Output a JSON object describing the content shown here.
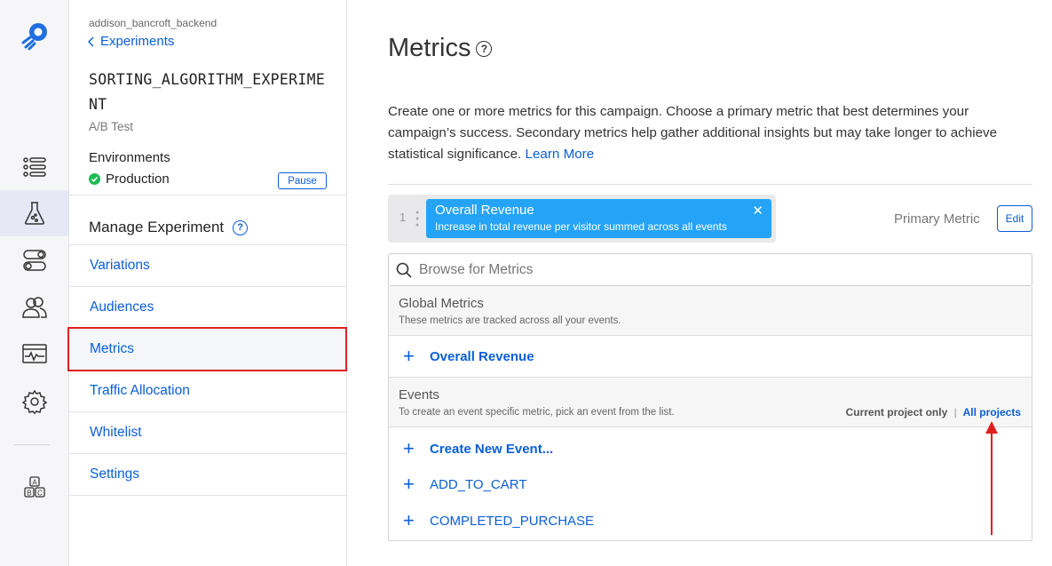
{
  "rail": {
    "items": [
      {
        "name": "list-icon"
      },
      {
        "name": "flask-icon"
      },
      {
        "name": "toggles-icon"
      },
      {
        "name": "audiences-icon"
      },
      {
        "name": "monitor-icon"
      },
      {
        "name": "gear-icon"
      },
      {
        "name": "abc-blocks-icon"
      }
    ]
  },
  "sidebar": {
    "project": "addison_bancroft_backend",
    "back_label": "Experiments",
    "experiment_name": "SORTING_ALGORITHM_EXPERIMENT",
    "experiment_type": "A/B Test",
    "environments_label": "Environments",
    "environment": "Production",
    "pause_label": "Pause",
    "manage_label": "Manage Experiment",
    "nav": [
      "Variations",
      "Audiences",
      "Metrics",
      "Traffic Allocation",
      "Whitelist",
      "Settings"
    ],
    "selected": "Metrics"
  },
  "main": {
    "title": "Metrics",
    "description": "Create one or more metrics for this campaign. Choose a primary metric that best determines your campaign’s success. Secondary metrics help gather additional insights but may take longer to achieve statistical significance.",
    "learn_more": "Learn More",
    "primary": {
      "index": "1",
      "name": "Overall Revenue",
      "subtitle": "Increase in total revenue per visitor summed across all events",
      "label": "Primary Metric",
      "edit_label": "Edit"
    },
    "search_placeholder": "Browse for Metrics",
    "global": {
      "title": "Global Metrics",
      "subtitle": "These metrics are tracked across all your events.",
      "items": [
        "Overall Revenue"
      ]
    },
    "events": {
      "title": "Events",
      "subtitle": "To create an event specific metric, pick an event from the list.",
      "filter_current": "Current project only",
      "filter_separator": "|",
      "filter_all": "All projects",
      "create_label": "Create New Event...",
      "items": [
        "ADD_TO_CART",
        "COMPLETED_PURCHASE"
      ]
    }
  },
  "colors": {
    "accent": "#0a5fd8",
    "chip": "#25a4f7",
    "highlight": "#e02020",
    "success": "#1db954"
  }
}
